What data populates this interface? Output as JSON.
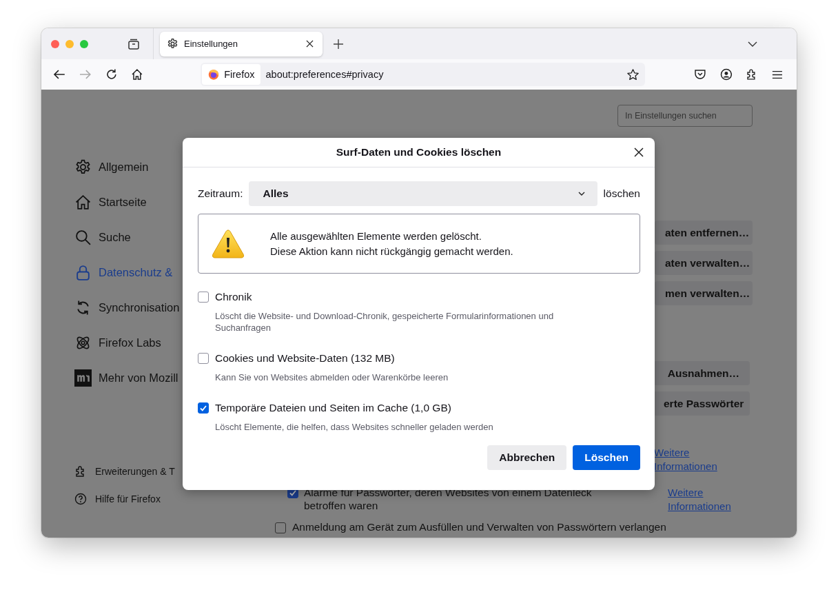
{
  "tabs": [
    {
      "label": "Einstellungen",
      "selected": true
    }
  ],
  "address_bar": {
    "identity": "Firefox",
    "url": "about:preferences#privacy"
  },
  "page": {
    "search": {
      "placeholder": "In Einstellungen suchen"
    },
    "sidebar": {
      "items": [
        {
          "label": "Allgemein",
          "selected": false
        },
        {
          "label": "Startseite",
          "selected": false
        },
        {
          "label": "Suche",
          "selected": false
        },
        {
          "label": "Datenschutz &",
          "selected": true
        },
        {
          "label": "Synchronisation",
          "selected": false
        },
        {
          "label": "Firefox Labs",
          "selected": false
        },
        {
          "label": "Mehr von Mozill",
          "selected": false
        }
      ],
      "footer": [
        "Erweiterungen & T",
        "Hilfe für Firefox"
      ]
    },
    "button_groups": [
      [
        "aten entfernen…",
        "aten verwalten…",
        "men verwalten…"
      ],
      [
        "Ausnahmen…",
        "erte Passwörter"
      ]
    ],
    "links": [
      "Weitere Informationen",
      "Weitere Informationen"
    ],
    "checkboxes": [
      {
        "label": "Alarme für Passwörter, deren Websites von einem Datenleck betroffen waren",
        "checked": true
      },
      {
        "label": "Anmeldung am Gerät zum Ausfüllen und Verwalten von Passwörtern verlangen",
        "checked": false
      }
    ]
  },
  "dialog": {
    "title": "Surf-Daten und Cookies löschen",
    "range_label": "Zeitraum:",
    "range_value": "Alles",
    "range_action": "löschen",
    "warning": [
      "Alle ausgewählten Elemente werden gelöscht.",
      "Diese Aktion kann nicht rückgängig gemacht werden."
    ],
    "options": [
      {
        "label": "Chronik",
        "description": "Löscht die Website- und Download-Chronik, gespeicherte Formularinformationen und Suchanfragen",
        "checked": false
      },
      {
        "label": "Cookies und Website-Daten (132 MB)",
        "description": "Kann Sie von Websites abmelden oder Warenkörbe leeren",
        "checked": false
      },
      {
        "label": "Temporäre Dateien und Seiten im Cache (1,0 GB)",
        "description": "Löscht Elemente, die helfen, dass Websites schneller geladen werden",
        "checked": true
      }
    ],
    "buttons": [
      {
        "label": "Abbrechen",
        "kind": "secondary"
      },
      {
        "label": "Löschen",
        "kind": "primary"
      }
    ]
  }
}
